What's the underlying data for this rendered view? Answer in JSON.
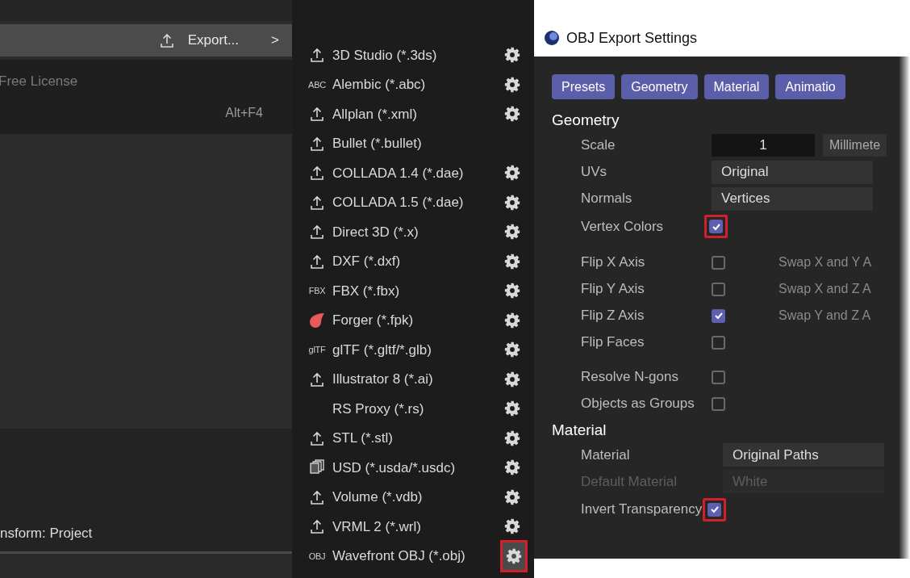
{
  "main_menu": {
    "export_item": {
      "label": "Export...",
      "chevron": ">"
    },
    "license_text": "Free License",
    "shortcut": "Alt+F4",
    "status_label": "nsform: Project"
  },
  "export_submenu": {
    "items": [
      {
        "label": "3D Studio (*.3ds)",
        "kind": "upload",
        "settings": true,
        "highlighted": false
      },
      {
        "label": "Alembic (*.abc)",
        "kind": "text",
        "badge": "ABC",
        "settings": true,
        "highlighted": false
      },
      {
        "label": "Allplan (*.xml)",
        "kind": "upload",
        "settings": true,
        "highlighted": false
      },
      {
        "label": "Bullet (*.bullet)",
        "kind": "upload",
        "settings": false
      },
      {
        "label": "COLLADA 1.4 (*.dae)",
        "kind": "upload",
        "settings": true,
        "highlighted": false
      },
      {
        "label": "COLLADA 1.5 (*.dae)",
        "kind": "upload",
        "settings": true,
        "highlighted": false
      },
      {
        "label": "Direct 3D (*.x)",
        "kind": "upload",
        "settings": true,
        "highlighted": false
      },
      {
        "label": "DXF (*.dxf)",
        "kind": "upload",
        "settings": true,
        "highlighted": false
      },
      {
        "label": "FBX (*.fbx)",
        "kind": "text",
        "badge": "FBX",
        "settings": true,
        "highlighted": false
      },
      {
        "label": "Forger (*.fpk)",
        "kind": "drop",
        "settings": true,
        "highlighted": false
      },
      {
        "label": "glTF (*.gltf/*.glb)",
        "kind": "text",
        "badge": "glTF",
        "settings": true,
        "highlighted": false
      },
      {
        "label": "Illustrator 8 (*.ai)",
        "kind": "upload",
        "settings": true,
        "highlighted": false
      },
      {
        "label": "RS Proxy (*.rs)",
        "kind": "none",
        "settings": true,
        "highlighted": false
      },
      {
        "label": "STL (*.stl)",
        "kind": "upload",
        "settings": true,
        "highlighted": false
      },
      {
        "label": "USD (*.usda/*.usdc)",
        "kind": "layers",
        "settings": true,
        "highlighted": false
      },
      {
        "label": "Volume (*.vdb)",
        "kind": "upload",
        "settings": true,
        "highlighted": false
      },
      {
        "label": "VRML 2 (*.wrl)",
        "kind": "upload",
        "settings": true,
        "highlighted": false
      },
      {
        "label": "Wavefront OBJ (*.obj)",
        "kind": "text",
        "badge": "OBJ",
        "settings": true,
        "highlighted": true
      }
    ]
  },
  "dialog": {
    "title": "OBJ Export Settings",
    "tabs": [
      {
        "label": "Presets",
        "selected": true
      },
      {
        "label": "Geometry",
        "selected": true
      },
      {
        "label": "Material",
        "selected": true
      },
      {
        "label": "Animatio",
        "selected": true
      }
    ],
    "geometry": {
      "heading": "Geometry",
      "scale": {
        "label": "Scale",
        "value": "1",
        "unit": "Millimete"
      },
      "uvs": {
        "label": "UVs",
        "value": "Original"
      },
      "normals": {
        "label": "Normals",
        "value": "Vertices"
      },
      "vertex_colors": {
        "label": "Vertex Colors",
        "checked": true,
        "highlighted": true
      },
      "flags": [
        {
          "label": "Flip X Axis",
          "checked": false,
          "swap_label": "Swap X and Y A"
        },
        {
          "label": "Flip Y Axis",
          "checked": false,
          "swap_label": "Swap X and Z A"
        },
        {
          "label": "Flip Z Axis",
          "checked": true,
          "swap_label": "Swap Y and Z A"
        },
        {
          "label": "Flip Faces",
          "checked": false
        }
      ],
      "options": [
        {
          "label": "Resolve N-gons",
          "checked": false
        },
        {
          "label": "Objects as Groups",
          "checked": false
        }
      ]
    },
    "material": {
      "heading": "Material",
      "material": {
        "label": "Material",
        "value": "Original Paths",
        "disabled": false
      },
      "default_material": {
        "label": "Default Material",
        "value": "White",
        "disabled": true
      },
      "invert_transparency": {
        "label": "Invert Transparency",
        "checked": true,
        "highlighted": true
      }
    }
  }
}
